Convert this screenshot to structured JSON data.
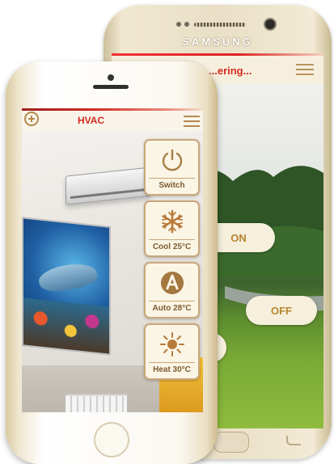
{
  "back_phone": {
    "brand": "SAMSUNG",
    "header_title": "...ering...",
    "buttons": {
      "on_label": "ON",
      "off_label": "OFF"
    }
  },
  "front_phone": {
    "header_title": "HVAC",
    "controls": [
      {
        "label": "Switch",
        "icon": "power-icon"
      },
      {
        "label": "Cool 25°C",
        "icon": "snowflake-icon"
      },
      {
        "label": "Auto 28°C",
        "icon": "auto-mode-icon"
      },
      {
        "label": "Heat 30°C",
        "icon": "sun-icon"
      }
    ]
  },
  "colors": {
    "accent_red": "#d52a1e",
    "gold": "#b8842f",
    "control_border": "#c9a77a"
  }
}
